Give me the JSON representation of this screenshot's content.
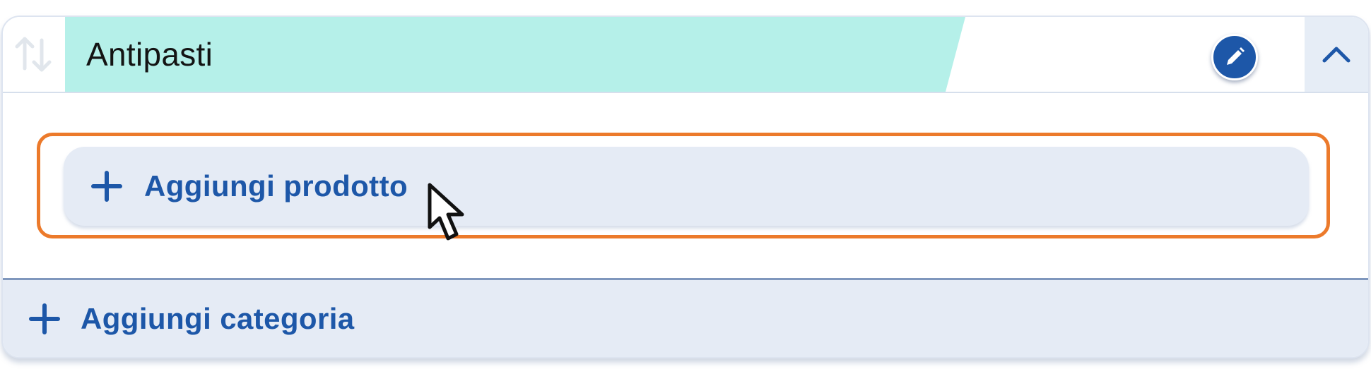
{
  "category": {
    "name": "Antipasti",
    "sort_icon": "sort-arrows-icon",
    "edit_icon": "pencil-icon",
    "collapse_icon": "chevron-up-icon",
    "tab_color": "#b5f0e9"
  },
  "products": {
    "add_label": "Aggiungi prodotto",
    "add_icon": "plus-icon",
    "highlight_color": "#ec7a2b"
  },
  "footer": {
    "add_category_label": "Aggiungi categoria",
    "add_icon": "plus-icon"
  },
  "colors": {
    "accent": "#1d57a8",
    "panel": "#e5ebf5"
  }
}
